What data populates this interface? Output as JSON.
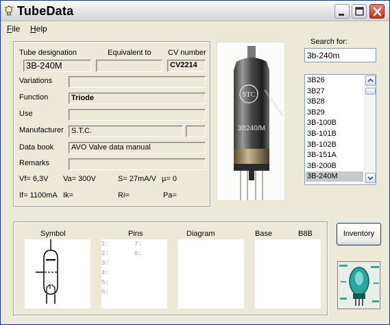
{
  "window": {
    "title": "TubeData",
    "app_icon": "lightbulb-icon",
    "buttons": [
      "minimize-icon",
      "maximize-icon",
      "close-icon"
    ]
  },
  "menu": {
    "file": {
      "label": "File",
      "accel": "F",
      "rest": "ile"
    },
    "help": {
      "label": "Help",
      "accel": "H",
      "rest": "elp"
    }
  },
  "details": {
    "tube_designation_label": "Tube designation",
    "tube_designation": "3B-240M",
    "equivalent_label": "Equivalent to",
    "equivalent": "",
    "cv_label": "CV number",
    "cv": "CV2214",
    "variations_label": "Variations",
    "variations": "",
    "function_label": "Function",
    "function": "Triode",
    "use_label": "Use",
    "use": "",
    "manufacturer_label": "Manufacturer",
    "manufacturer": "S.T.C.",
    "manufacturer_extra": "",
    "databook_label": "Data book",
    "databook": "AVO Valve data manual",
    "remarks_label": "Remarks",
    "remarks": "",
    "specs": {
      "vf": "Vf= 6,3V",
      "va": "Va= 300V",
      "s": "S= 27mA/V",
      "mu": "µ=   0",
      "if": "If= 1100mA",
      "ik": "Ik=",
      "ri": "Ri=",
      "pa": "Pa="
    }
  },
  "photo": {
    "print_brand": "STC",
    "print_type": "3B240/M",
    "print_origin": "MADE IN ENGLAND"
  },
  "search": {
    "label": "Search for:",
    "value": "3b-240m",
    "results": [
      "3B26",
      "3B27",
      "3B28",
      "3B29",
      "3B-100B",
      "3B-101B",
      "3B-102B",
      "3B-151A",
      "3B-200B",
      "3B-240M"
    ],
    "selected_index": 9
  },
  "bottom": {
    "symbol_label": "Symbol",
    "pins_label": "Pins",
    "diagram_label": "Diagram",
    "base_label": "Base",
    "base_value": "B8B",
    "pins": [
      "1:",
      "2:",
      "3:",
      "4:",
      "5:",
      "6:",
      "7:",
      "8:"
    ]
  },
  "inventory_button": "Inventory",
  "colors": {
    "titlebar": "#e4e4e4",
    "window_bg": "#ece9d8",
    "close": "#c9311a",
    "selection": "#c8c8c8"
  }
}
